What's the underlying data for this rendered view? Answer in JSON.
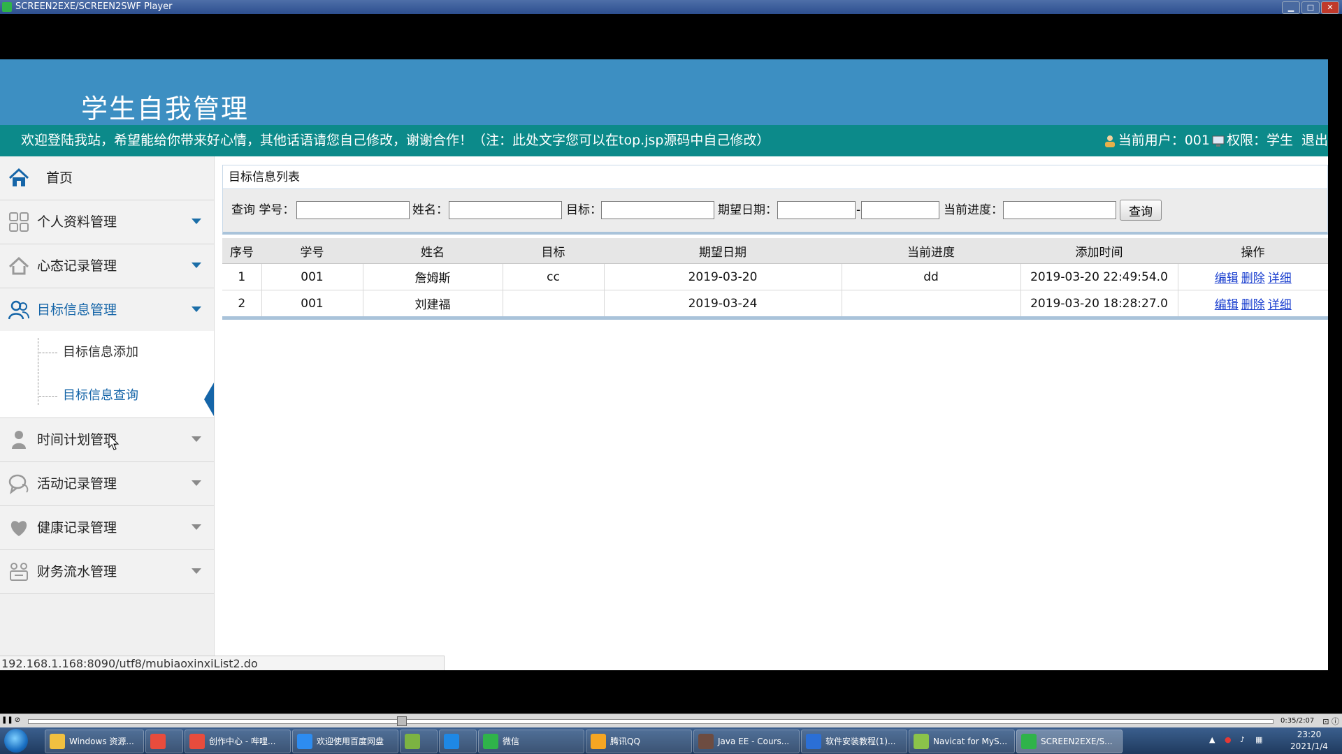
{
  "window": {
    "title": "SCREEN2EXE/SCREEN2SWF Player",
    "minimize": "▁",
    "maximize": "□",
    "close": "✕"
  },
  "header": {
    "site_title": "学生自我管理",
    "welcome": "欢迎登陆我站，希望能给你带来好心情，其他话语请您自己修改，谢谢合作！（注：此处文字您可以在top.jsp源码中自己修改）",
    "current_user_label": "当前用户：001",
    "role_label": "权限：学生",
    "logout": "退出"
  },
  "sidebar": {
    "items": [
      {
        "label": "首页",
        "icon": "home-icon"
      },
      {
        "label": "个人资料管理",
        "icon": "grid-icon"
      },
      {
        "label": "心态记录管理",
        "icon": "house-icon"
      },
      {
        "label": "目标信息管理",
        "icon": "users-icon"
      },
      {
        "label": "时间计划管理",
        "icon": "person-icon"
      },
      {
        "label": "活动记录管理",
        "icon": "chat-icon"
      },
      {
        "label": "健康记录管理",
        "icon": "heart-icon"
      },
      {
        "label": "财务流水管理",
        "icon": "finance-icon"
      }
    ],
    "submenu": [
      {
        "label": "目标信息添加"
      },
      {
        "label": "目标信息查询"
      }
    ]
  },
  "content": {
    "panel_title": "目标信息列表",
    "search": {
      "query_label": "查询 学号：",
      "name_label": "姓名：",
      "goal_label": "目标：",
      "date_label": "期望日期：",
      "date_dash": "-",
      "progress_label": "当前进度：",
      "button": "查询",
      "student_id_value": "",
      "name_value": "",
      "goal_value": "",
      "date_from_value": "",
      "date_to_value": "",
      "progress_value": ""
    },
    "table": {
      "headers": [
        "序号",
        "学号",
        "姓名",
        "目标",
        "期望日期",
        "当前进度",
        "添加时间",
        "操作"
      ],
      "rows": [
        {
          "no": "1",
          "student_id": "001",
          "name": "詹姆斯",
          "goal": "cc",
          "date": "2019-03-20",
          "progress": "dd",
          "added": "2019-03-20 22:49:54.0"
        },
        {
          "no": "2",
          "student_id": "001",
          "name": "刘建福",
          "goal": "",
          "date": "2019-03-24",
          "progress": "",
          "added": "2019-03-20 18:28:27.0"
        }
      ],
      "actions": {
        "edit": "编辑",
        "delete": "删除",
        "detail": "详细"
      }
    }
  },
  "status_url": "192.168.1.168:8090/utf8/mubiaoxinxiList2.do",
  "player": {
    "pause": "❚❚",
    "stop": "⊘",
    "time": "0:35/2:07",
    "controls": "⊡ ⓘ",
    "progress_fraction": 0.3
  },
  "taskbar": {
    "tasks": [
      {
        "label": "Windows 资源...",
        "color": "#f0c040"
      },
      {
        "label": "",
        "color": "#e84c3d"
      },
      {
        "label": "创作中心 - 哔哩...",
        "color": "#e84c3d"
      },
      {
        "label": "欢迎使用百度网盘",
        "color": "#2d8cf0"
      },
      {
        "label": "",
        "color": "#7cb342"
      },
      {
        "label": "",
        "color": "#1e88e5"
      },
      {
        "label": "微信",
        "color": "#2fb34a"
      },
      {
        "label": "腾讯QQ",
        "color": "#f5a623"
      },
      {
        "label": "Java EE - Cours...",
        "color": "#6d4c41"
      },
      {
        "label": "软件安装教程(1)...",
        "color": "#2b6fd6"
      },
      {
        "label": "Navicat for MyS...",
        "color": "#8bc34a"
      },
      {
        "label": "SCREEN2EXE/S...",
        "color": "#2fb34a"
      }
    ],
    "clock_time": "23:20",
    "clock_date": "2021/1/4"
  },
  "colors": {
    "header_bg": "#3d8fc2",
    "welcome_bg": "#0c8a8a",
    "link": "#1a3fcf",
    "accent": "#1565a8"
  }
}
